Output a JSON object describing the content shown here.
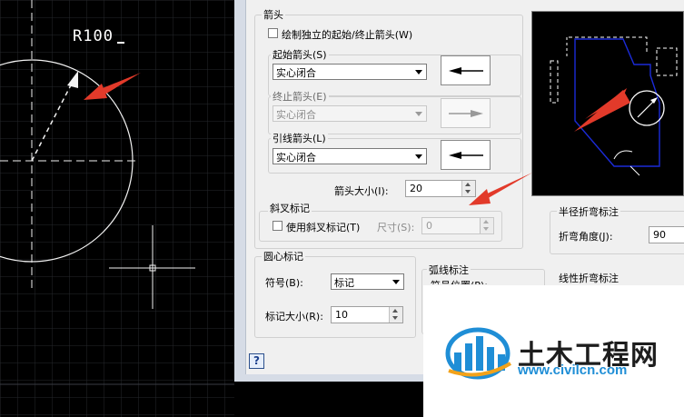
{
  "canvas": {
    "dimension_text": "R100"
  },
  "arrowheads": {
    "group_title": "箭头",
    "independent_checkbox_label": "绘制独立的起始/终止箭头(W)",
    "start_label": "起始箭头(S)",
    "start_value": "实心闭合",
    "end_label": "终止箭头(E)",
    "end_value": "实心闭合",
    "leader_label": "引线箭头(L)",
    "leader_value": "实心闭合",
    "size_label": "箭头大小(I):",
    "size_value": "20"
  },
  "oblique": {
    "group_title": "斜叉标记",
    "checkbox_label": "使用斜叉标记(T)",
    "size_label": "尺寸(S):",
    "size_value": "0"
  },
  "center_mark": {
    "group_title": "圆心标记",
    "symbol_label": "符号(B):",
    "symbol_value": "标记",
    "size_label": "标记大小(R):",
    "size_value": "10"
  },
  "arc_length": {
    "group_title": "弧线标注",
    "partial_label": "符号位置(P):"
  },
  "radius_jog": {
    "group_title": "半径折弯标注",
    "angle_label": "折弯角度(J):",
    "angle_value": "90"
  },
  "linear_jog": {
    "group_title": "线性折弯标注"
  },
  "help_button": "?",
  "watermark": {
    "name": "土木工程网",
    "url": "www.civilcn.com"
  },
  "colors": {
    "cad_background": "#000000",
    "annotation_arrow": "#e23a2a",
    "preview_outline": "#1b2bd8",
    "watermark_blue": "#1f8ed6"
  }
}
